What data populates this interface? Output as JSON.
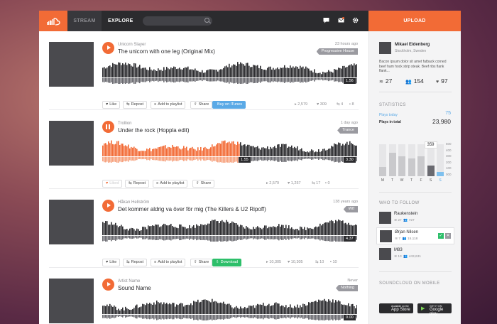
{
  "topbar": {
    "stream": "STREAM",
    "explore": "EXPLORE",
    "upload": "UPLOAD",
    "search_placeholder": ""
  },
  "colors": {
    "accent": "#f26b36",
    "dark": "#2b2b2e",
    "blue": "#5aa9e6",
    "green": "#2dbf6a"
  },
  "tracks": [
    {
      "artist": "Unicorn Slayer",
      "title": "The unicorn with one leg (Original Mix)",
      "time": "23 hours ago",
      "tag": "Progressive House",
      "duration": "1.56",
      "state": "play",
      "progress": 0,
      "buttons": {
        "like": "Like",
        "repost": "Repost",
        "playlist": "Add to playlist",
        "share": "Share",
        "extra": "Buy on iTunes"
      },
      "stats": {
        "plays": "2,579",
        "likes": "309",
        "reposts": "4",
        "comments": "8"
      }
    },
    {
      "artist": "Trollion",
      "title": "Under the rock (Hoppla edit)",
      "time": "1 day ago",
      "tag": "Trance",
      "duration": "3.30",
      "elapsed": "1.55",
      "state": "pause",
      "progress": 0.54,
      "buttons": {
        "like": "Liked",
        "repost": "Repost",
        "playlist": "Add to playlist",
        "share": "Share"
      },
      "stats": {
        "plays": "2,579",
        "likes": "1,257",
        "reposts": "17",
        "comments": "0"
      }
    },
    {
      "artist": "Håkan Hellström",
      "title": "Det kommer aldrig va över för mig (The Killers & U2 Ripoff)",
      "time": "138 years ago",
      "tag": "Wtf",
      "duration": "4.37",
      "state": "play",
      "progress": 0,
      "buttons": {
        "like": "Like",
        "repost": "Repost",
        "playlist": "Add to playlist",
        "share": "Share",
        "extra": "Download"
      },
      "stats": {
        "plays": "10,305",
        "likes": "10,305",
        "reposts": "10",
        "comments": "10"
      }
    },
    {
      "artist": "Artist Name",
      "title": "Sound Name",
      "time": "Never",
      "tag": "Nothing",
      "duration": "0.00",
      "state": "play",
      "progress": 0
    }
  ],
  "profile": {
    "name": "Mikael Eidenberg",
    "location": "Stockholm, Sweden",
    "bio": "Bacon ipsum dolor sit amet fatback corned beef ham hock strip steak. Beef ribs flank flank...",
    "tracks": "27",
    "followers": "154",
    "likes": "97"
  },
  "statistics": {
    "heading": "STATISTICS",
    "plays_today_label": "Plays today",
    "plays_today": "75",
    "plays_total_label": "Plays in total",
    "plays_total": "23,980",
    "tooltip": "359",
    "days": [
      "M",
      "T",
      "W",
      "T",
      "F",
      "S",
      "S"
    ],
    "levels": [
      0.28,
      0.74,
      0.62,
      0.56,
      0.62,
      0.34,
      0.14
    ],
    "yticks": [
      "500",
      "400",
      "300",
      "200",
      "100",
      "000"
    ]
  },
  "who_to_follow": {
    "heading": "WHO TO FOLLOW",
    "people": [
      {
        "name": "Raukenstein",
        "tracks": "27",
        "followers": "727"
      },
      {
        "name": "Ørjan Nilsen",
        "tracks": "7",
        "followers": "15,118"
      },
      {
        "name": "M83",
        "tracks": "13",
        "followers": "443,631"
      }
    ]
  },
  "mobile": {
    "heading": "SOUNDCLOUD ON MOBILE",
    "appstore_small": "Available on the",
    "appstore": "App Store",
    "google_small": "GET IT ON",
    "google": "Google play"
  }
}
